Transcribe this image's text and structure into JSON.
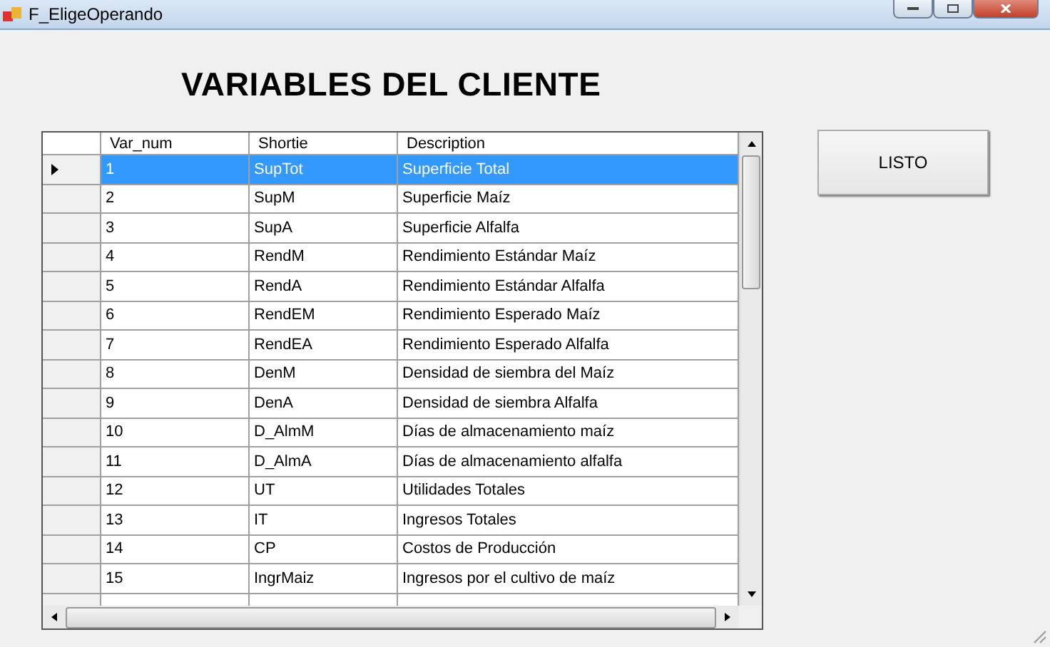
{
  "window": {
    "title": "F_EligeOperando"
  },
  "heading": "VARIABLES DEL CLIENTE",
  "table": {
    "columns": [
      "Var_num",
      "Shortie",
      "Description"
    ],
    "rows": [
      {
        "cells": [
          "1",
          "SupTot",
          "Superficie Total"
        ],
        "selected": true
      },
      {
        "cells": [
          "2",
          "SupM",
          "Superficie Maíz"
        ],
        "selected": false
      },
      {
        "cells": [
          "3",
          "SupA",
          "Superficie Alfalfa"
        ],
        "selected": false
      },
      {
        "cells": [
          "4",
          "RendM",
          "Rendimiento Estándar Maíz"
        ],
        "selected": false
      },
      {
        "cells": [
          "5",
          "RendA",
          "Rendimiento Estándar Alfalfa"
        ],
        "selected": false
      },
      {
        "cells": [
          "6",
          "RendEM",
          "Rendimiento Esperado Maíz"
        ],
        "selected": false
      },
      {
        "cells": [
          "7",
          "RendEA",
          "Rendimiento Esperado Alfalfa"
        ],
        "selected": false
      },
      {
        "cells": [
          "8",
          "DenM",
          "Densidad de siembra del Maíz"
        ],
        "selected": false
      },
      {
        "cells": [
          "9",
          "DenA",
          "Densidad de siembra Alfalfa"
        ],
        "selected": false
      },
      {
        "cells": [
          "10",
          "D_AlmM",
          "Días de almacenamiento maíz"
        ],
        "selected": false
      },
      {
        "cells": [
          "11",
          "D_AlmA",
          "Días de almacenamiento alfalfa"
        ],
        "selected": false
      },
      {
        "cells": [
          "12",
          "UT",
          "Utilidades Totales"
        ],
        "selected": false
      },
      {
        "cells": [
          "13",
          "IT",
          "Ingresos Totales"
        ],
        "selected": false
      },
      {
        "cells": [
          "14",
          "CP",
          "Costos de Producción"
        ],
        "selected": false
      },
      {
        "cells": [
          "15",
          "IngrMaiz",
          "Ingresos por el cultivo de maíz"
        ],
        "selected": false
      }
    ]
  },
  "button": "LISTO"
}
